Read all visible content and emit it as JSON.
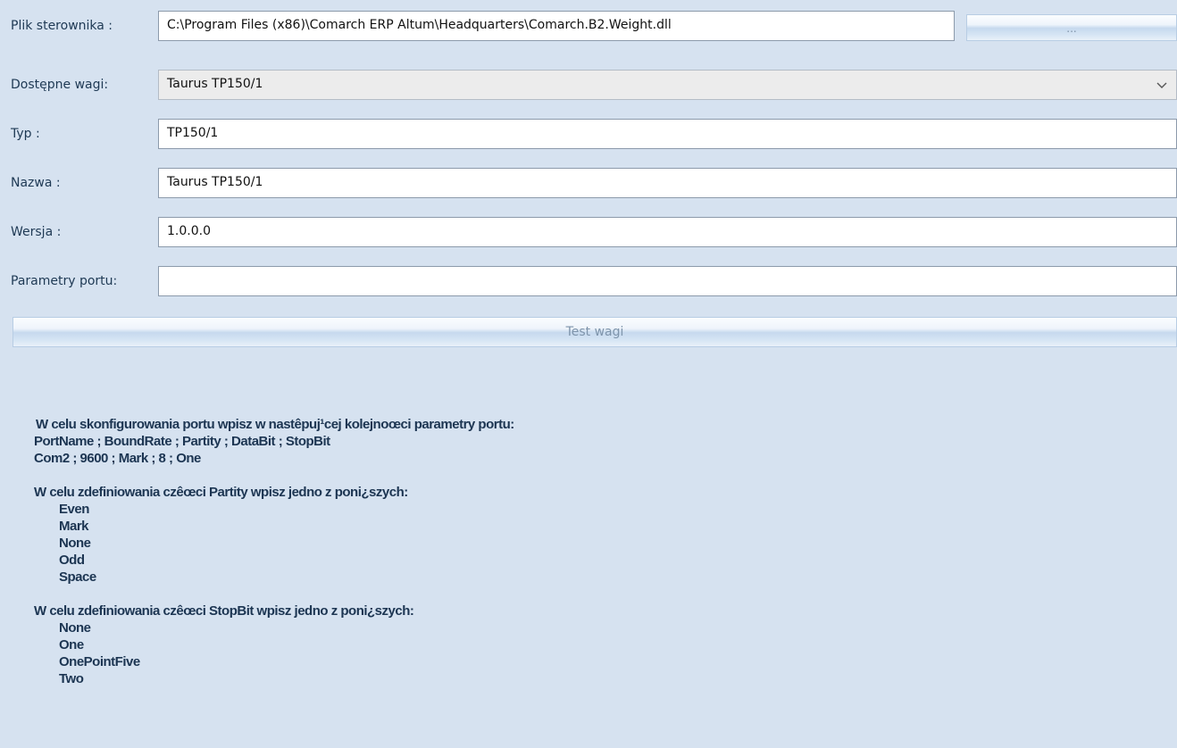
{
  "form": {
    "plik_label": "Plik sterownika :",
    "plik_value": "C:\\Program Files (x86)\\Comarch ERP Altum\\Headquarters\\Comarch.B2.Weight.dll",
    "browse_label": "...",
    "wagi_label": "Dostępne wagi:",
    "wagi_value": "Taurus TP150/1",
    "typ_label": "Typ :",
    "typ_value": "TP150/1",
    "nazwa_label": "Nazwa :",
    "nazwa_value": "Taurus TP150/1",
    "wersja_label": "Wersja :",
    "wersja_value": "1.0.0.0",
    "parametry_label": "Parametry portu:",
    "parametry_value": "",
    "test_label": "Test wagi"
  },
  "info": {
    "line1": " W celu skonfigurowania portu wpisz w nastêpuj¹cej kolejnoœci parametry portu:",
    "line2": "PortName ; BoundRate ; Partity ; DataBit ; StopBit",
    "line3": "Com2 ; 9600 ; Mark ; 8 ; One",
    "parity_header": "W celu zdefiniowania czêœci Partity wpisz jedno z poni¿szych:",
    "parity_options": [
      "Even",
      "Mark",
      "None",
      "Odd",
      "Space"
    ],
    "stopbit_header": " W celu zdefiniowania czêœci StopBit wpisz jedno z poni¿szych:",
    "stopbit_options": [
      "None",
      "One",
      "OnePointFive",
      "Two"
    ]
  },
  "icons": {
    "combo_arrow": "chevron-down-icon"
  },
  "colors": {
    "background": "#d6e2f0",
    "label_text": "#1e3954",
    "info_text": "#1c3552"
  }
}
